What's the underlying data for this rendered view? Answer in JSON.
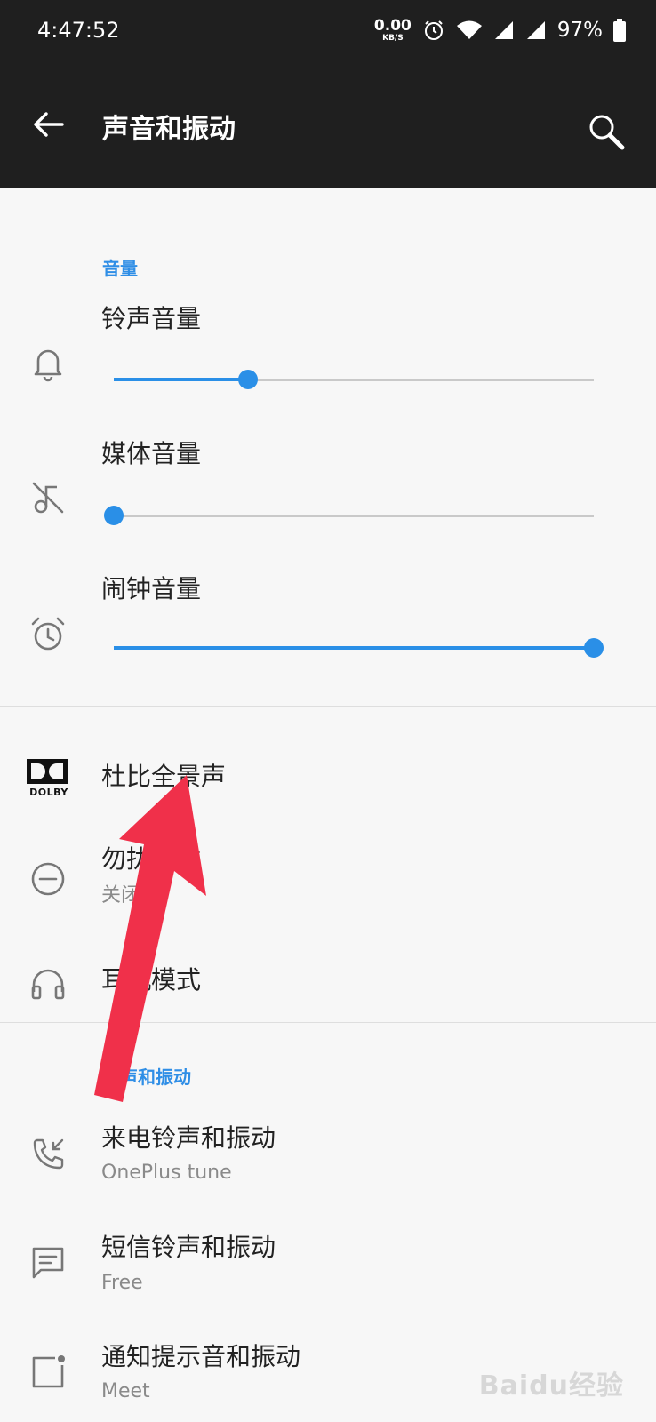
{
  "status_bar": {
    "time": "4:47:52",
    "net_speed_value": "0.00",
    "net_speed_unit": "KB/S",
    "battery": "97%",
    "icons": [
      "alarm-icon",
      "wifi-icon",
      "signal-icon",
      "signal-icon",
      "battery-icon"
    ]
  },
  "app_bar": {
    "title": "声音和振动",
    "icons": [
      "back-arrow-icon",
      "search-icon"
    ]
  },
  "volume": {
    "header": "音量",
    "ring": {
      "label": "铃声音量",
      "level": 0.28
    },
    "media": {
      "label": "媒体音量",
      "level": 0.0
    },
    "alarm": {
      "label": "闹钟音量",
      "level": 1.0
    }
  },
  "items": {
    "dolby": {
      "title": "杜比全景声",
      "icon_text": "DOLBY"
    },
    "dnd": {
      "title": "勿扰模式",
      "subtitle": "关闭"
    },
    "earphone": {
      "title": "耳机模式"
    }
  },
  "ringtone_section": {
    "header": "铃声和振动",
    "call": {
      "title": "来电铃声和振动",
      "subtitle": "OnePlus tune"
    },
    "sms": {
      "title": "短信铃声和振动",
      "subtitle": "Free"
    },
    "notification": {
      "title": "通知提示音和振动",
      "subtitle": "Meet"
    }
  },
  "watermark": "Baidu经验",
  "colors": {
    "accent": "#2a8fe7",
    "bar": "#1f1f1f",
    "annotation_arrow": "#f0304a"
  }
}
